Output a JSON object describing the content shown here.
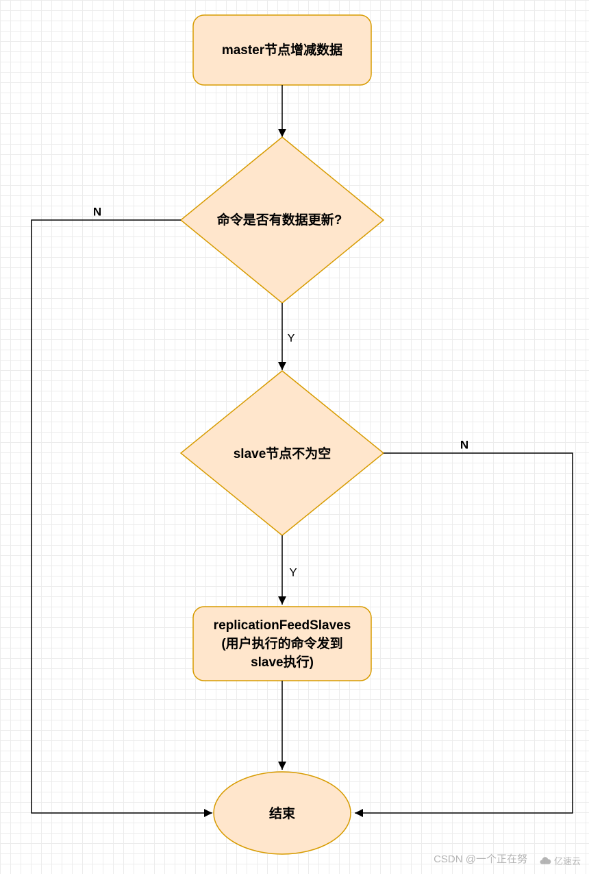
{
  "nodes": {
    "start": "master节点增减数据",
    "decision1": "命令是否有数据更新?",
    "decision2": "slave节点不为空",
    "process2_line1": "replicationFeedSlaves",
    "process2_line2": "(用户执行的命令发到",
    "process2_line3": "slave执行)",
    "end": "结束"
  },
  "edges": {
    "d1_no": "N",
    "d1_yes": "Y",
    "d2_no": "N",
    "d2_yes": "Y"
  },
  "watermark": {
    "csdn": "CSDN @一个正在努",
    "yisu": "亿速云"
  }
}
